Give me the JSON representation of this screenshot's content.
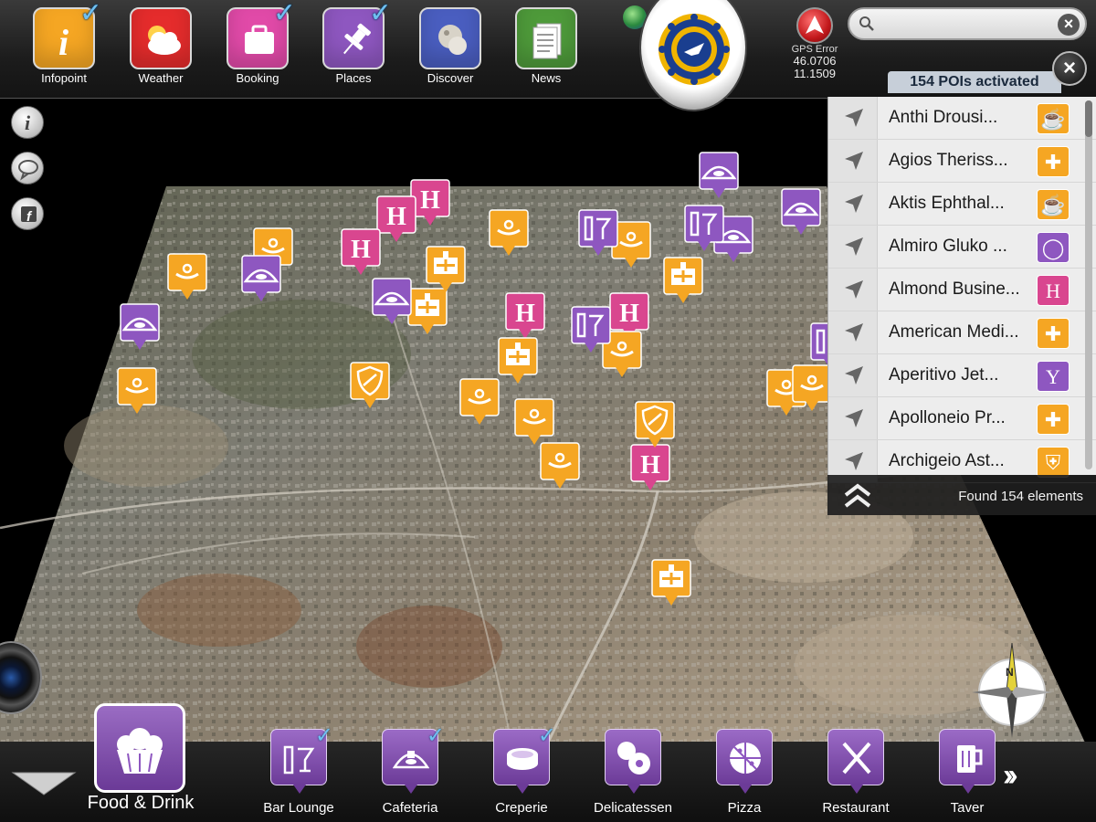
{
  "topbar": {
    "apps": [
      {
        "label": "Infopoint",
        "icon": "info-icon",
        "color": "#f5a623",
        "checked": true
      },
      {
        "label": "Weather",
        "icon": "weather-icon",
        "color": "#e52c2c",
        "checked": false
      },
      {
        "label": "Booking",
        "icon": "suitcase-icon",
        "color": "#e14aa8",
        "checked": true
      },
      {
        "label": "Places",
        "icon": "pushpin-icon",
        "color": "#8e57c0",
        "checked": true
      },
      {
        "label": "Discover",
        "icon": "discover-icon",
        "color": "#4a5ec0",
        "checked": false
      },
      {
        "label": "News",
        "icon": "news-icon",
        "color": "#4e9a3a",
        "checked": false
      }
    ],
    "gps": {
      "label": "GPS Error",
      "lat": "46.0706",
      "lon": "11.1509"
    },
    "search": {
      "placeholder": "",
      "value": ""
    },
    "poi_count_label": "154 POIs activated"
  },
  "poi_panel": {
    "items": [
      {
        "name": "Anthi Drousi...",
        "category": "coffee",
        "color": "#f5a623",
        "glyph": "☕"
      },
      {
        "name": "Agios Theriss...",
        "category": "hospital",
        "color": "#f5a623",
        "glyph": "✚"
      },
      {
        "name": "Aktis Ephthal...",
        "category": "coffee",
        "color": "#f5a623",
        "glyph": "☕"
      },
      {
        "name": "Almiro Gluko ...",
        "category": "creperie",
        "color": "#8e57c0",
        "glyph": "◯"
      },
      {
        "name": "Almond Busine...",
        "category": "hotel",
        "color": "#d9468f",
        "glyph": "H"
      },
      {
        "name": "American Medi...",
        "category": "hospital",
        "color": "#f5a623",
        "glyph": "✚"
      },
      {
        "name": "Aperitivo Jet...",
        "category": "bar",
        "color": "#8e57c0",
        "glyph": "Y"
      },
      {
        "name": "Apolloneio Pr...",
        "category": "hospital",
        "color": "#f5a623",
        "glyph": "✚"
      },
      {
        "name": "Archigeio Ast...",
        "category": "police",
        "color": "#f5a623",
        "glyph": "⛨"
      }
    ],
    "found_label": "Found 154 elements"
  },
  "bottombar": {
    "current_category": "Food & Drink",
    "categories": [
      {
        "label": "Bar Lounge",
        "icon": "cocktail-icon",
        "checked": true
      },
      {
        "label": "Cafeteria",
        "icon": "cafeteria-icon",
        "checked": true
      },
      {
        "label": "Creperie",
        "icon": "crepe-icon",
        "checked": true
      },
      {
        "label": "Delicatessen",
        "icon": "delicatessen-icon",
        "checked": false
      },
      {
        "label": "Pizza",
        "icon": "pizza-icon",
        "checked": false
      },
      {
        "label": "Restaurant",
        "icon": "restaurant-icon",
        "checked": false
      },
      {
        "label": "Taver",
        "icon": "beer-icon",
        "checked": false
      }
    ]
  },
  "map_markers": [
    {
      "type": "hotel",
      "glyph": "H",
      "color": "#d9468f"
    },
    {
      "type": "coffee",
      "glyph": "☕",
      "color": "#f5a623"
    },
    {
      "type": "hospital",
      "glyph": "✚",
      "color": "#f5a623"
    },
    {
      "type": "cafeteria",
      "glyph": "◠",
      "color": "#8e57c0"
    },
    {
      "type": "bar",
      "glyph": "Y",
      "color": "#8e57c0"
    },
    {
      "type": "police",
      "glyph": "⛨",
      "color": "#f5a623"
    }
  ]
}
